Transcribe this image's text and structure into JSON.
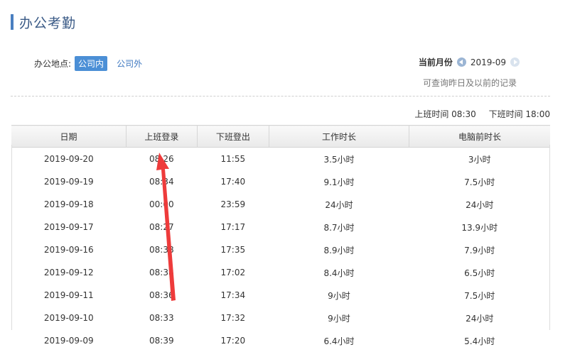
{
  "header": {
    "title": "办公考勤"
  },
  "location": {
    "label": "办公地点:",
    "options": [
      "公司内",
      "公司外"
    ],
    "selected": "公司内"
  },
  "month": {
    "label": "当前月份",
    "value": "2019-09",
    "hint": "可查询昨日及以前的记录"
  },
  "work_hours": {
    "start": "上班时间 08:30",
    "end": "下班时间 18:00"
  },
  "table": {
    "headers": [
      "日期",
      "上班登录",
      "下班登出",
      "工作时长",
      "电脑前时长"
    ],
    "rows": [
      [
        "2019-09-20",
        "08:26",
        "11:55",
        "3.5小时",
        "3小时"
      ],
      [
        "2019-09-19",
        "08:34",
        "17:40",
        "9.1小时",
        "7.5小时"
      ],
      [
        "2019-09-18",
        "00:00",
        "23:59",
        "24小时",
        "24小时"
      ],
      [
        "2019-09-17",
        "08:27",
        "17:17",
        "8.7小时",
        "13.9小时"
      ],
      [
        "2019-09-16",
        "08:38",
        "17:35",
        "8.9小时",
        "7.9小时"
      ],
      [
        "2019-09-12",
        "08:38",
        "17:02",
        "8.4小时",
        "6.5小时"
      ],
      [
        "2019-09-11",
        "08:36",
        "17:34",
        "9小时",
        "7.5小时"
      ],
      [
        "2019-09-10",
        "08:33",
        "17:32",
        "9小时",
        "24小时"
      ],
      [
        "2019-09-09",
        "08:39",
        "17:20",
        "6.4小时",
        "5.4小时"
      ]
    ]
  },
  "colors": {
    "accent": "#4b8fd6",
    "title": "#3a5a86",
    "annotation": "#ee3b3b"
  }
}
